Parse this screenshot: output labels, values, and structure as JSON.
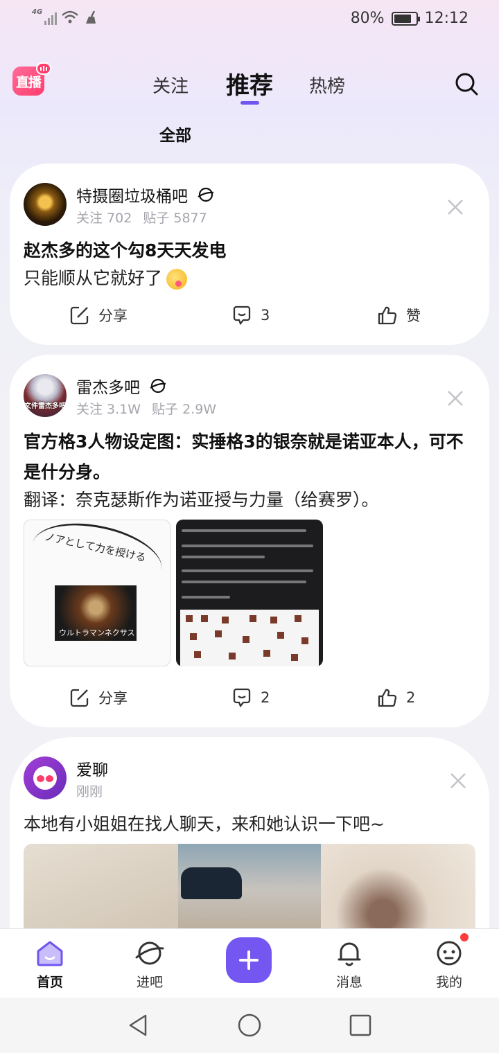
{
  "status_bar": {
    "network": "4G",
    "battery": "80%",
    "battery_level": 0.8,
    "time": "12:12"
  },
  "header": {
    "live_label": "直播",
    "tabs": [
      {
        "label": "关注"
      },
      {
        "label": "推荐"
      },
      {
        "label": "热榜"
      }
    ],
    "active_tab": "推荐",
    "subtab": "全部"
  },
  "feed": [
    {
      "forum": "特摄圈垃圾桶吧",
      "follow_label": "关注 702",
      "posts_label": "贴子 5877",
      "title": "赵杰多的这个勾8天天发电",
      "body": "只能顺从它就好了",
      "share": "分享",
      "comments": "3",
      "like": "赞"
    },
    {
      "forum": "雷杰多吧",
      "avatar_text": "文件雷杰多吧",
      "follow_label": "关注 3.1W",
      "posts_label": "贴子 2.9W",
      "title": "官方格3人物设定图：实捶格3的银奈就是诺亚本人，可不是什分身。",
      "body": "翻译：奈克瑟斯作为诺亚授与力量（给赛罗）。",
      "image1_text": "ノアとして力を授ける",
      "image1_caption": "ウルトラマンネクサス",
      "share": "分享",
      "comments": "2",
      "like": "2"
    },
    {
      "forum": "爱聊",
      "time": "刚刚",
      "body": "本地有小姐姐在找人聊天，来和她认识一下吧~"
    }
  ],
  "bottom_nav": [
    {
      "label": "首页"
    },
    {
      "label": "进吧"
    },
    {
      "label": "消息"
    },
    {
      "label": "我的"
    }
  ],
  "colors": {
    "accent": "#7357f0",
    "live": "#ff3d6d",
    "notification": "#ff3b3b"
  }
}
